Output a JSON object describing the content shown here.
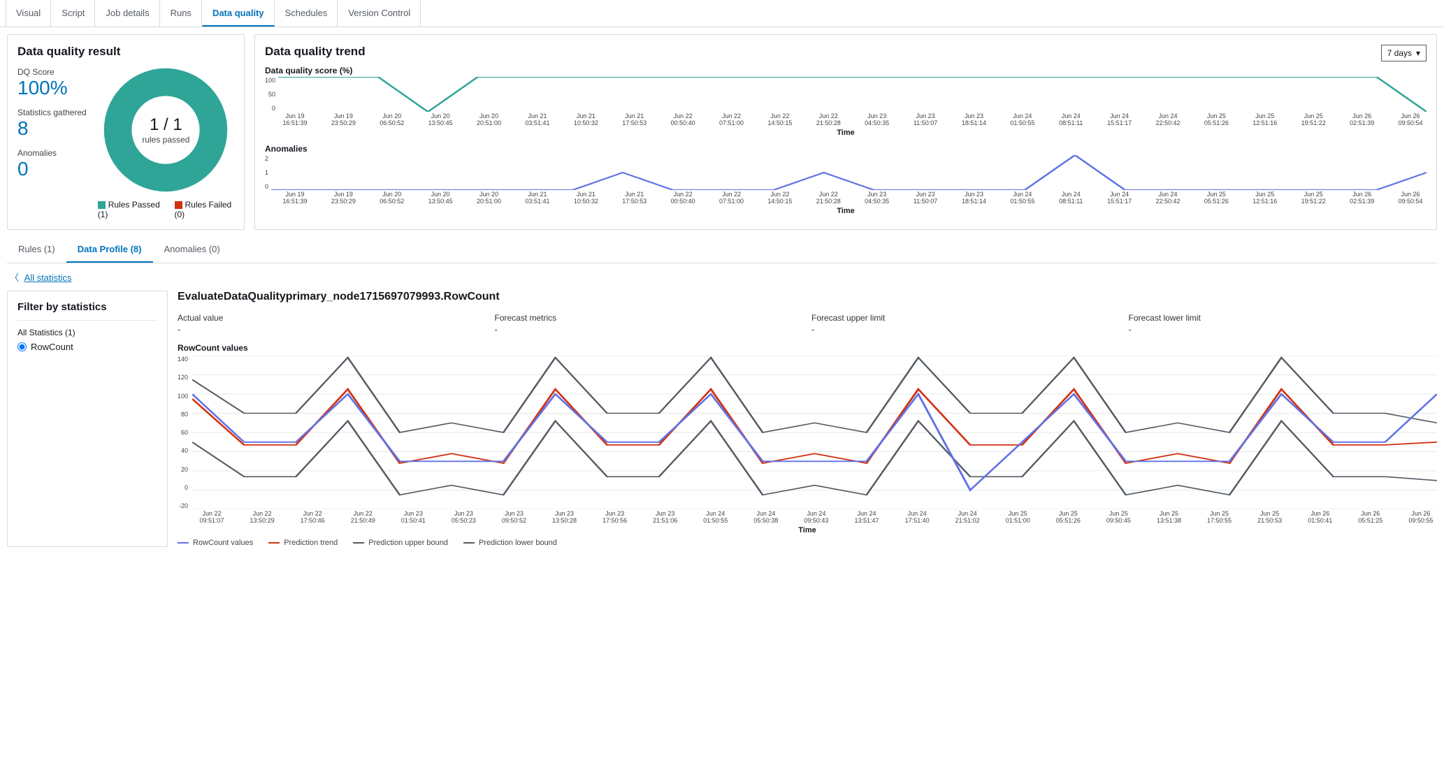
{
  "top_tabs": {
    "items": [
      "Visual",
      "Script",
      "Job details",
      "Runs",
      "Data quality",
      "Schedules",
      "Version Control"
    ],
    "active_index": 4
  },
  "dq_result": {
    "title": "Data quality result",
    "score_label": "DQ Score",
    "score_value": "100%",
    "stats_label": "Statistics gathered",
    "stats_value": "8",
    "anom_label": "Anomalies",
    "anom_value": "0",
    "donut_big": "1 / 1",
    "donut_small": "rules passed",
    "legend_pass": "Rules Passed (1)",
    "legend_fail": "Rules Failed (0)"
  },
  "dq_trend": {
    "title": "Data quality trend",
    "range": "7 days",
    "score_title": "Data quality score (%)",
    "anom_title": "Anomalies",
    "time_label": "Time",
    "x_ticks": [
      "Jun 19\n16:51:39",
      "Jun 19\n23:50:29",
      "Jun 20\n06:50:52",
      "Jun 20\n13:50:45",
      "Jun 20\n20:51:00",
      "Jun 21\n03:51:41",
      "Jun 21\n10:50:32",
      "Jun 21\n17:50:53",
      "Jun 22\n00:50:40",
      "Jun 22\n07:51:00",
      "Jun 22\n14:50:15",
      "Jun 22\n21:50:28",
      "Jun 23\n04:50:35",
      "Jun 23\n11:50:07",
      "Jun 23\n18:51:14",
      "Jun 24\n01:50:55",
      "Jun 24\n08:51:11",
      "Jun 24\n15:51:17",
      "Jun 24\n22:50:42",
      "Jun 25\n05:51:26",
      "Jun 25\n12:51:16",
      "Jun 25\n19:51:22",
      "Jun 26\n02:51:39",
      "Jun 26\n09:50:54"
    ]
  },
  "sub_tabs": {
    "items": [
      "Rules (1)",
      "Data Profile (8)",
      "Anomalies (0)"
    ],
    "active_index": 1
  },
  "back_link": "All statistics",
  "filter": {
    "title": "Filter by statistics",
    "all_label": "All Statistics (1)",
    "item": "RowCount"
  },
  "profile": {
    "node_title": "EvaluateDataQualityprimary_node1715697079993.RowCount",
    "cols": {
      "actual_label": "Actual value",
      "actual_value": "-",
      "forecast_label": "Forecast metrics",
      "forecast_value": "-",
      "upper_label": "Forecast upper limit",
      "upper_value": "-",
      "lower_label": "Forecast lower limit",
      "lower_value": "-"
    },
    "big_title": "RowCount values",
    "time_label": "Time",
    "x_ticks": [
      "Jun 22\n09:51:07",
      "Jun 22\n13:50:29",
      "Jun 22\n17:50:46",
      "Jun 22\n21:50:49",
      "Jun 23\n01:50:41",
      "Jun 23\n05:50:23",
      "Jun 23\n09:50:52",
      "Jun 23\n13:50:28",
      "Jun 23\n17:50:56",
      "Jun 23\n21:51:06",
      "Jun 24\n01:50:55",
      "Jun 24\n05:50:38",
      "Jun 24\n09:50:43",
      "Jun 24\n13:51:47",
      "Jun 24\n17:51:40",
      "Jun 24\n21:51:02",
      "Jun 25\n01:51:00",
      "Jun 25\n05:51:26",
      "Jun 25\n09:50:45",
      "Jun 25\n13:51:38",
      "Jun 25\n17:50:55",
      "Jun 25\n21:50:53",
      "Jun 26\n01:50:41",
      "Jun 26\n05:51:25",
      "Jun 26\n09:50:55"
    ],
    "legend": {
      "rowcount": "RowCount values",
      "trend": "Prediction trend",
      "upper": "Prediction upper bound",
      "lower": "Prediction lower bound"
    }
  },
  "chart_data": [
    {
      "type": "line",
      "title": "Data quality score (%)",
      "ylim": [
        0,
        100
      ],
      "y_ticks": [
        0,
        50,
        100
      ],
      "xlabel": "Time",
      "categories": [
        "Jun 19 16:51:39",
        "Jun 19 23:50:29",
        "Jun 20 06:50:52",
        "Jun 20 13:50:45",
        "Jun 20 20:51:00",
        "Jun 21 03:51:41",
        "Jun 21 10:50:32",
        "Jun 21 17:50:53",
        "Jun 22 00:50:40",
        "Jun 22 07:51:00",
        "Jun 22 14:50:15",
        "Jun 22 21:50:28",
        "Jun 23 04:50:35",
        "Jun 23 11:50:07",
        "Jun 23 18:51:14",
        "Jun 24 01:50:55",
        "Jun 24 08:51:11",
        "Jun 24 15:51:17",
        "Jun 24 22:50:42",
        "Jun 25 05:51:26",
        "Jun 25 12:51:16",
        "Jun 25 19:51:22",
        "Jun 26 02:51:39",
        "Jun 26 09:50:54"
      ],
      "series": [
        {
          "name": "Data quality score",
          "color": "#2ea597",
          "values": [
            100,
            100,
            100,
            0,
            100,
            100,
            100,
            100,
            100,
            100,
            100,
            100,
            100,
            100,
            100,
            100,
            100,
            100,
            100,
            100,
            100,
            100,
            100,
            0
          ]
        }
      ]
    },
    {
      "type": "line",
      "title": "Anomalies",
      "ylim": [
        0,
        2
      ],
      "y_ticks": [
        0,
        1,
        2
      ],
      "xlabel": "Time",
      "categories": [
        "Jun 19 16:51:39",
        "Jun 19 23:50:29",
        "Jun 20 06:50:52",
        "Jun 20 13:50:45",
        "Jun 20 20:51:00",
        "Jun 21 03:51:41",
        "Jun 21 10:50:32",
        "Jun 21 17:50:53",
        "Jun 22 00:50:40",
        "Jun 22 07:51:00",
        "Jun 22 14:50:15",
        "Jun 22 21:50:28",
        "Jun 23 04:50:35",
        "Jun 23 11:50:07",
        "Jun 23 18:51:14",
        "Jun 24 01:50:55",
        "Jun 24 08:51:11",
        "Jun 24 15:51:17",
        "Jun 24 22:50:42",
        "Jun 25 05:51:26",
        "Jun 25 12:51:16",
        "Jun 25 19:51:22",
        "Jun 26 02:51:39",
        "Jun 26 09:50:54"
      ],
      "series": [
        {
          "name": "Anomalies",
          "color": "#6072e6",
          "values": [
            0,
            0,
            0,
            0,
            0,
            0,
            0,
            1,
            0,
            0,
            0,
            1,
            0,
            0,
            0,
            0,
            2,
            0,
            0,
            0,
            0,
            0,
            0,
            1
          ]
        }
      ]
    },
    {
      "type": "line",
      "title": "RowCount values",
      "ylim": [
        -20,
        140
      ],
      "y_ticks": [
        -20,
        0,
        20,
        40,
        60,
        80,
        100,
        120,
        140
      ],
      "xlabel": "Time",
      "categories": [
        "Jun 22 09:51:07",
        "Jun 22 13:50:29",
        "Jun 22 17:50:46",
        "Jun 22 21:50:49",
        "Jun 23 01:50:41",
        "Jun 23 05:50:23",
        "Jun 23 09:50:52",
        "Jun 23 13:50:28",
        "Jun 23 17:50:56",
        "Jun 23 21:51:06",
        "Jun 24 01:50:55",
        "Jun 24 05:50:38",
        "Jun 24 09:50:43",
        "Jun 24 13:51:47",
        "Jun 24 17:51:40",
        "Jun 24 21:51:02",
        "Jun 25 01:51:00",
        "Jun 25 05:51:26",
        "Jun 25 09:50:45",
        "Jun 25 13:51:38",
        "Jun 25 17:50:55",
        "Jun 25 21:50:53",
        "Jun 26 01:50:41",
        "Jun 26 05:51:25",
        "Jun 26 09:50:55"
      ],
      "series": [
        {
          "name": "RowCount values",
          "color": "#6072e6",
          "values": [
            100,
            50,
            50,
            100,
            30,
            30,
            30,
            100,
            50,
            50,
            100,
            30,
            30,
            30,
            100,
            0,
            50,
            100,
            30,
            30,
            30,
            100,
            50,
            50,
            100
          ]
        },
        {
          "name": "Prediction trend",
          "color": "#d13212",
          "values": [
            95,
            47,
            47,
            105,
            28,
            38,
            28,
            105,
            47,
            47,
            105,
            28,
            38,
            28,
            105,
            47,
            47,
            105,
            28,
            38,
            28,
            105,
            47,
            47,
            50
          ]
        },
        {
          "name": "Prediction upper bound",
          "color": "#545b64",
          "values": [
            115,
            80,
            80,
            138,
            60,
            70,
            60,
            138,
            80,
            80,
            138,
            60,
            70,
            60,
            138,
            80,
            80,
            138,
            60,
            70,
            60,
            138,
            80,
            80,
            70
          ]
        },
        {
          "name": "Prediction lower bound",
          "color": "#545b64",
          "values": [
            50,
            14,
            14,
            72,
            -5,
            5,
            -5,
            72,
            14,
            14,
            72,
            -5,
            5,
            -5,
            72,
            14,
            14,
            72,
            -5,
            5,
            -5,
            72,
            14,
            14,
            10
          ]
        }
      ]
    }
  ],
  "colors": {
    "teal": "#2ea597",
    "red": "#d13212",
    "blue": "#6072e6",
    "slate": "#545b64"
  }
}
